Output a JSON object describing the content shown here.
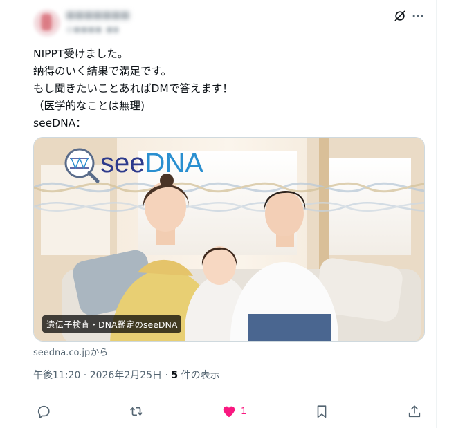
{
  "author": {
    "name": "■■■■■■■■",
    "handle": "@■■■■_■■■■"
  },
  "post": {
    "lines": [
      "NIPPT受けました。",
      "納得のいく結果で満足です。",
      "もし聞きたいことあればDMで答えます！",
      "（医学的なことは無理)",
      "seeDNA："
    ]
  },
  "card": {
    "logo_text": "seeDNA",
    "logo_prefix": "see",
    "logo_suffix": "DNA",
    "caption": "遺伝子検査・DNA鑑定のseeDNA",
    "source": "seedna.co.jpから"
  },
  "meta": {
    "timestamp": "午後11:20 · 2026年2月25日 · ",
    "views_count": "5",
    "views_label": " 件の表示"
  },
  "actions": {
    "like_count": "1"
  },
  "colors": {
    "like": "#f91880",
    "text": "#0f1419",
    "secondary": "#536471",
    "logo_see": "#2d3a8c",
    "logo_dna": "#2a8fd0"
  },
  "icons": [
    "grok-icon",
    "more-icon",
    "reply-icon",
    "repost-icon",
    "like-icon",
    "bookmark-icon",
    "share-icon"
  ]
}
